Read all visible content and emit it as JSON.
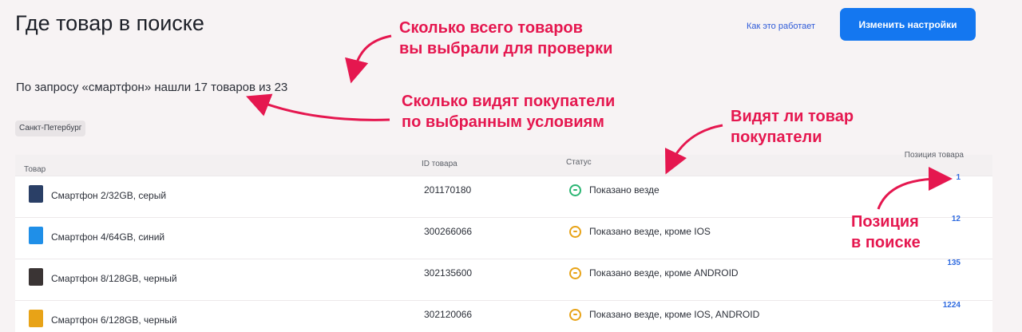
{
  "header": {
    "title": "Где товар в поиске",
    "help_link": "Как это работает",
    "settings_button": "Изменить настройки"
  },
  "summary": {
    "text": "По запросу «смартфон» нашли 17 товаров из 23",
    "region": "Санкт-Петербург"
  },
  "table": {
    "columns": [
      "Товар",
      "ID товара",
      "Статус",
      "Позиция товара"
    ],
    "rows": [
      {
        "name": "Смартфон 2/32GB, серый",
        "id": "201170180",
        "status": "Показано везде",
        "status_color": "#2bb673",
        "position": "1",
        "thumb_color": "#2a3f66"
      },
      {
        "name": "Смартфон 4/64GB, синий",
        "id": "300266066",
        "status": "Показано везде, кроме IOS",
        "status_color": "#e8a317",
        "position": "12",
        "thumb_color": "#1f8fe8"
      },
      {
        "name": "Смартфон 8/128GB, черный",
        "id": "302135600",
        "status": "Показано везде, кроме ANDROID",
        "status_color": "#e8a317",
        "position": "135",
        "thumb_color": "#3a3434"
      },
      {
        "name": "Смартфон 6/128GB, черный",
        "id": "302120066",
        "status": "Показано везде, кроме IOS, ANDROID",
        "status_color": "#e8a317",
        "position": "1224",
        "thumb_color": "#e8a317"
      }
    ]
  },
  "annotations": {
    "selected_count": "Сколько всего товаров\nвы выбрали для проверки",
    "visible_count": "Сколько видят покупатели\nпо выбранным условиям",
    "visibility": "Видят ли товар\nпокупатели",
    "position": "Позиция\nв поиске"
  },
  "colors": {
    "accent": "#1477f0",
    "annotation": "#e5174f",
    "status_ok": "#2bb673",
    "status_partial": "#e8a317"
  }
}
